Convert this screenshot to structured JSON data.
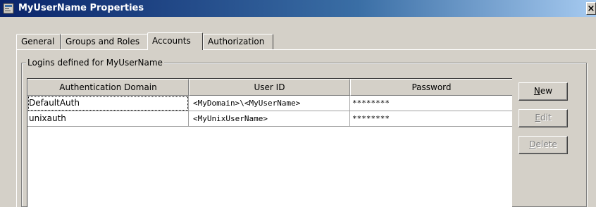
{
  "window": {
    "title": "MyUserName Properties",
    "close_label": "×"
  },
  "tabs": [
    {
      "label": "General"
    },
    {
      "label": "Groups and Roles"
    },
    {
      "label": "Accounts",
      "active": true
    },
    {
      "label": "Authorization"
    }
  ],
  "group": {
    "label": "Logins defined for MyUserName"
  },
  "table": {
    "columns": [
      "Authentication Domain",
      "User ID",
      "Password"
    ],
    "rows": [
      {
        "domain": "DefaultAuth",
        "user_id": "<MyDomain>\\<MyUserName>",
        "password": "********"
      },
      {
        "domain": "unixauth",
        "user_id": "<MyUnixUserName>",
        "password": "********"
      }
    ]
  },
  "buttons": {
    "new": {
      "label": "New",
      "enabled": true
    },
    "edit": {
      "label": "Edit",
      "enabled": false
    },
    "delete": {
      "label": "Delete",
      "enabled": false
    }
  },
  "colors": {
    "titlebar": "#0a246a",
    "face": "#d4d0c8"
  }
}
